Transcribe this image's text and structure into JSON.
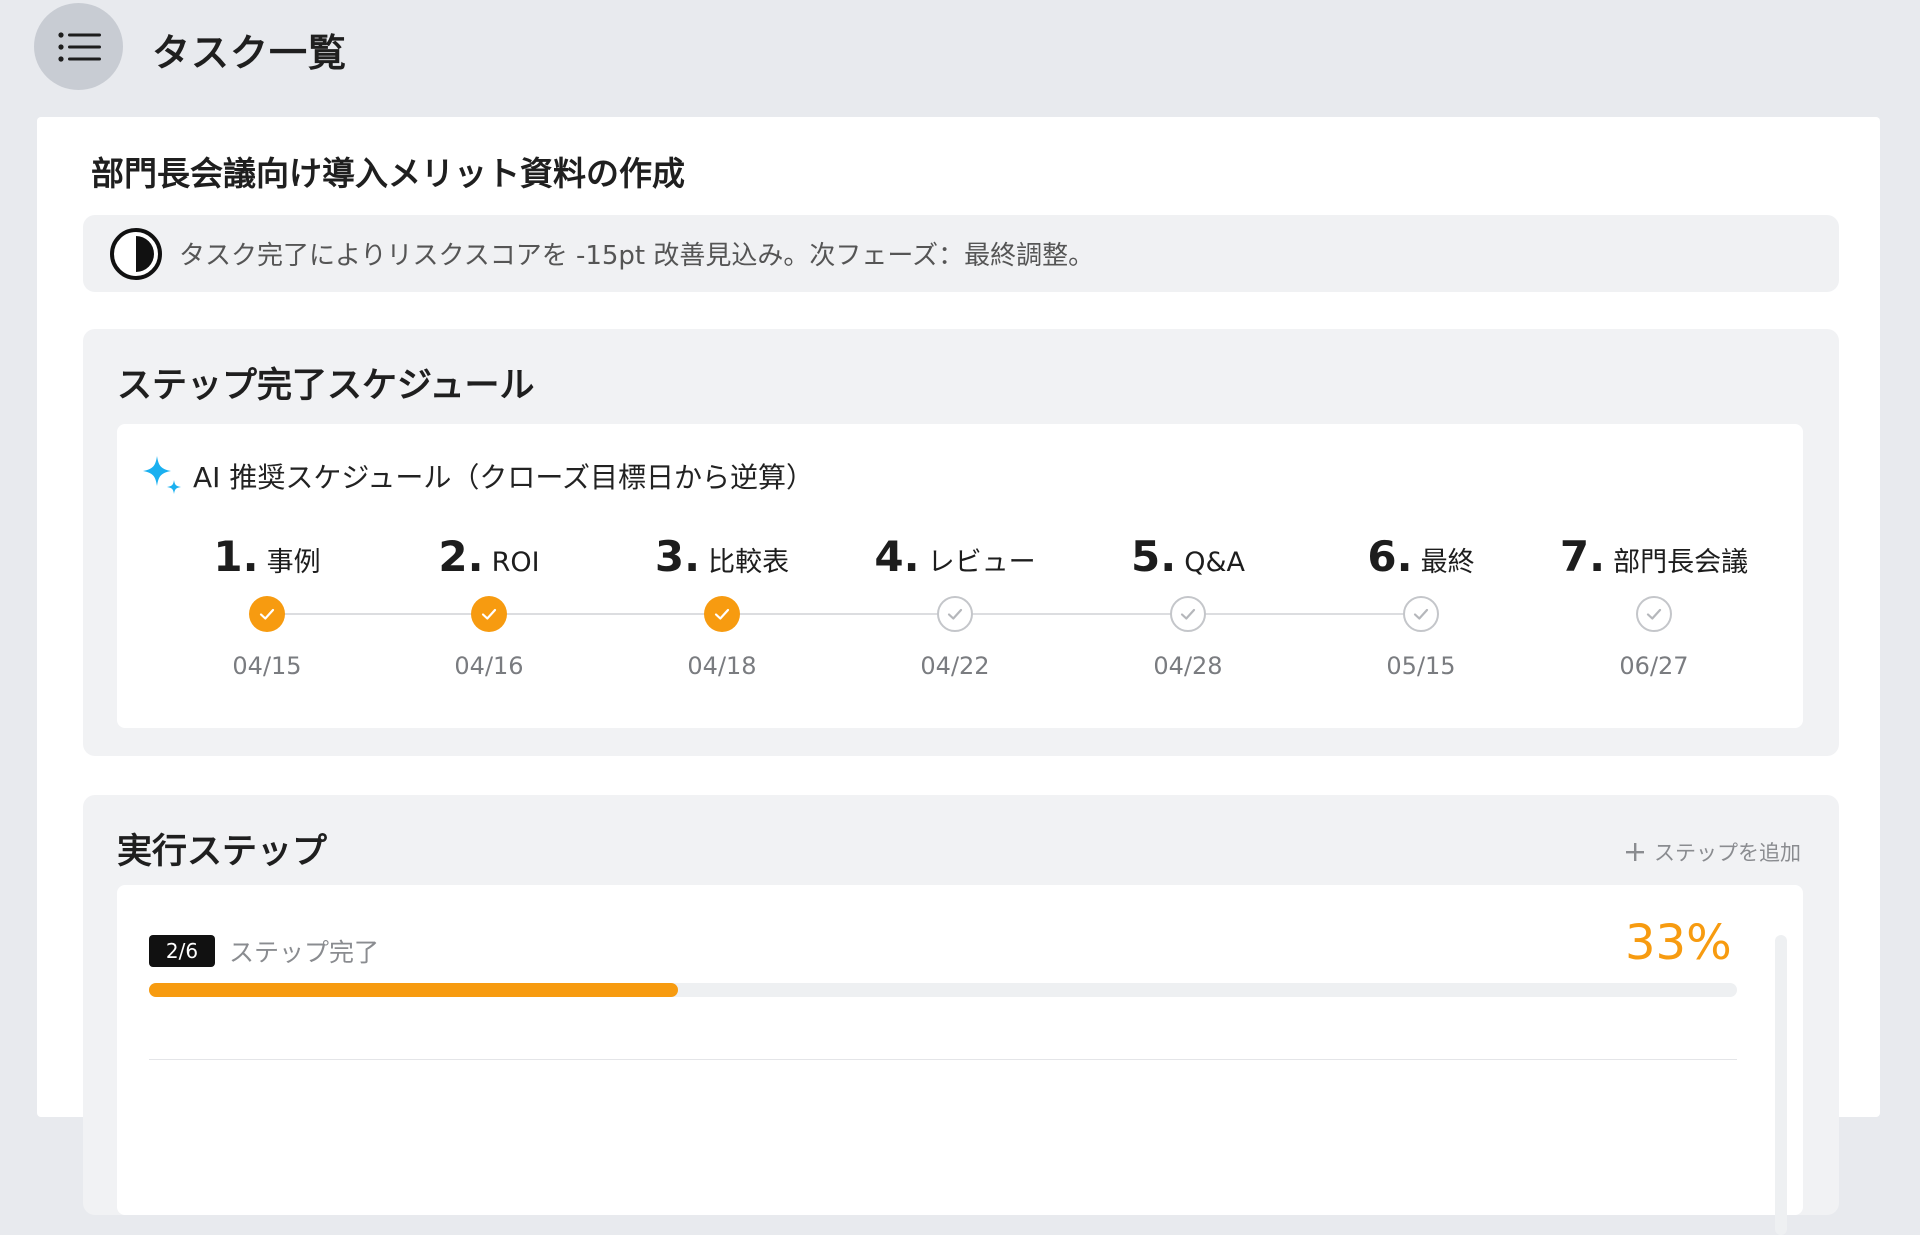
{
  "header": {
    "menu_icon": "list-icon",
    "title": "タスク一覧"
  },
  "task": {
    "title": "部門長会議向け導入メリット資料の作成",
    "note_icon": "half-circle-icon",
    "note": "タスク完了によりリスクスコアを -15pt 改善見込み。次フェーズ：最終調整。"
  },
  "schedule": {
    "title": "ステップ完了スケジュール",
    "ai_icon": "sparkle-icon",
    "ai_label": "AI 推奨スケジュール（クローズ目標日から逆算）",
    "steps": [
      {
        "num": "1.",
        "name": "事例",
        "date": "04/15",
        "done": true
      },
      {
        "num": "2.",
        "name": "ROI",
        "date": "04/16",
        "done": true
      },
      {
        "num": "3.",
        "name": "比較表",
        "date": "04/18",
        "done": true
      },
      {
        "num": "4.",
        "name": "レビュー",
        "date": "04/22",
        "done": false
      },
      {
        "num": "5.",
        "name": "Q&A",
        "date": "04/28",
        "done": false
      },
      {
        "num": "6.",
        "name": "最終",
        "date": "05/15",
        "done": false
      },
      {
        "num": "7.",
        "name": "部門長会議",
        "date": "06/27",
        "done": false
      }
    ]
  },
  "execution": {
    "title": "実行ステップ",
    "add_label": "ステップを追加",
    "count": "2/6",
    "count_label": "ステップ完了",
    "percent": "33%",
    "progress": 0.3333
  },
  "colors": {
    "accent": "#f79b10",
    "background": "#e8eaee",
    "ai_icon": "#1ab0f0"
  }
}
